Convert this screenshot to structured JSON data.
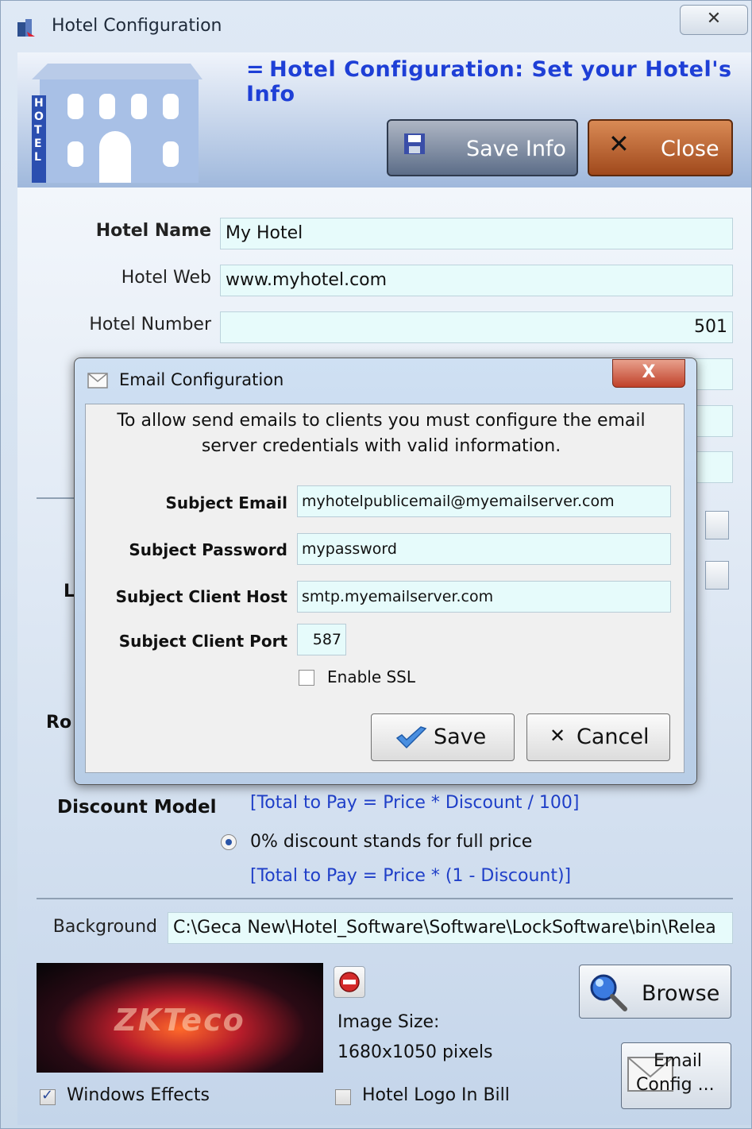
{
  "window": {
    "title": "Hotel Configuration",
    "close_glyph": "✕"
  },
  "header": {
    "title": "Hotel Configuration: Set your Hotel's Info",
    "building_sign": "HOTEL",
    "save_info_label": "Save Info",
    "close_label": "Close"
  },
  "form": {
    "hotel_name_label": "Hotel Name",
    "hotel_name_value": "My Hotel",
    "hotel_web_label": "Hotel Web",
    "hotel_web_value": "www.myhotel.com",
    "hotel_number_label": "Hotel Number",
    "hotel_number_value": "501",
    "partial_label_l": "L",
    "partial_label_ro": "Ro"
  },
  "discount": {
    "label": "Discount Model",
    "formula_1": "[Total to Pay = Price * Discount / 100]",
    "option_2_label": "0% discount stands for full price",
    "formula_2": "[Total to Pay = Price * (1 - Discount)]"
  },
  "background": {
    "label": "Background",
    "path_value": "C:\\Geca New\\Hotel_Software\\Software\\LockSoftware\\bin\\Relea",
    "preview_logo": "ZKTeco",
    "image_size_label": "Image Size:",
    "image_size_value": "1680x1050 pixels",
    "browse_label": "Browse",
    "email_config_label_1": "Email",
    "email_config_label_2": "Config ..."
  },
  "options": {
    "windows_effects_label": "Windows Effects",
    "windows_effects_checked": true,
    "hotel_logo_label": "Hotel Logo In Bill",
    "hotel_logo_checked": false
  },
  "email_dialog": {
    "title": "Email Configuration",
    "close_glyph": "X",
    "message": "To allow send emails to clients you must configure the email server credentials with valid information.",
    "subject_email_label": "Subject Email",
    "subject_email_value": "myhotelpublicemail@myemailserver.com",
    "subject_password_label": "Subject Password",
    "subject_password_value": "mypassword",
    "subject_host_label": "Subject Client Host",
    "subject_host_value": "smtp.myemailserver.com",
    "subject_port_label": "Subject Client Port",
    "subject_port_value": "587",
    "enable_ssl_label": "Enable SSL",
    "enable_ssl_checked": false,
    "save_label": "Save",
    "cancel_label": "Cancel"
  },
  "colors": {
    "accent_blue": "#1e3fd6",
    "close_button": "#a0491c",
    "field_bg": "#e7fbfb"
  }
}
